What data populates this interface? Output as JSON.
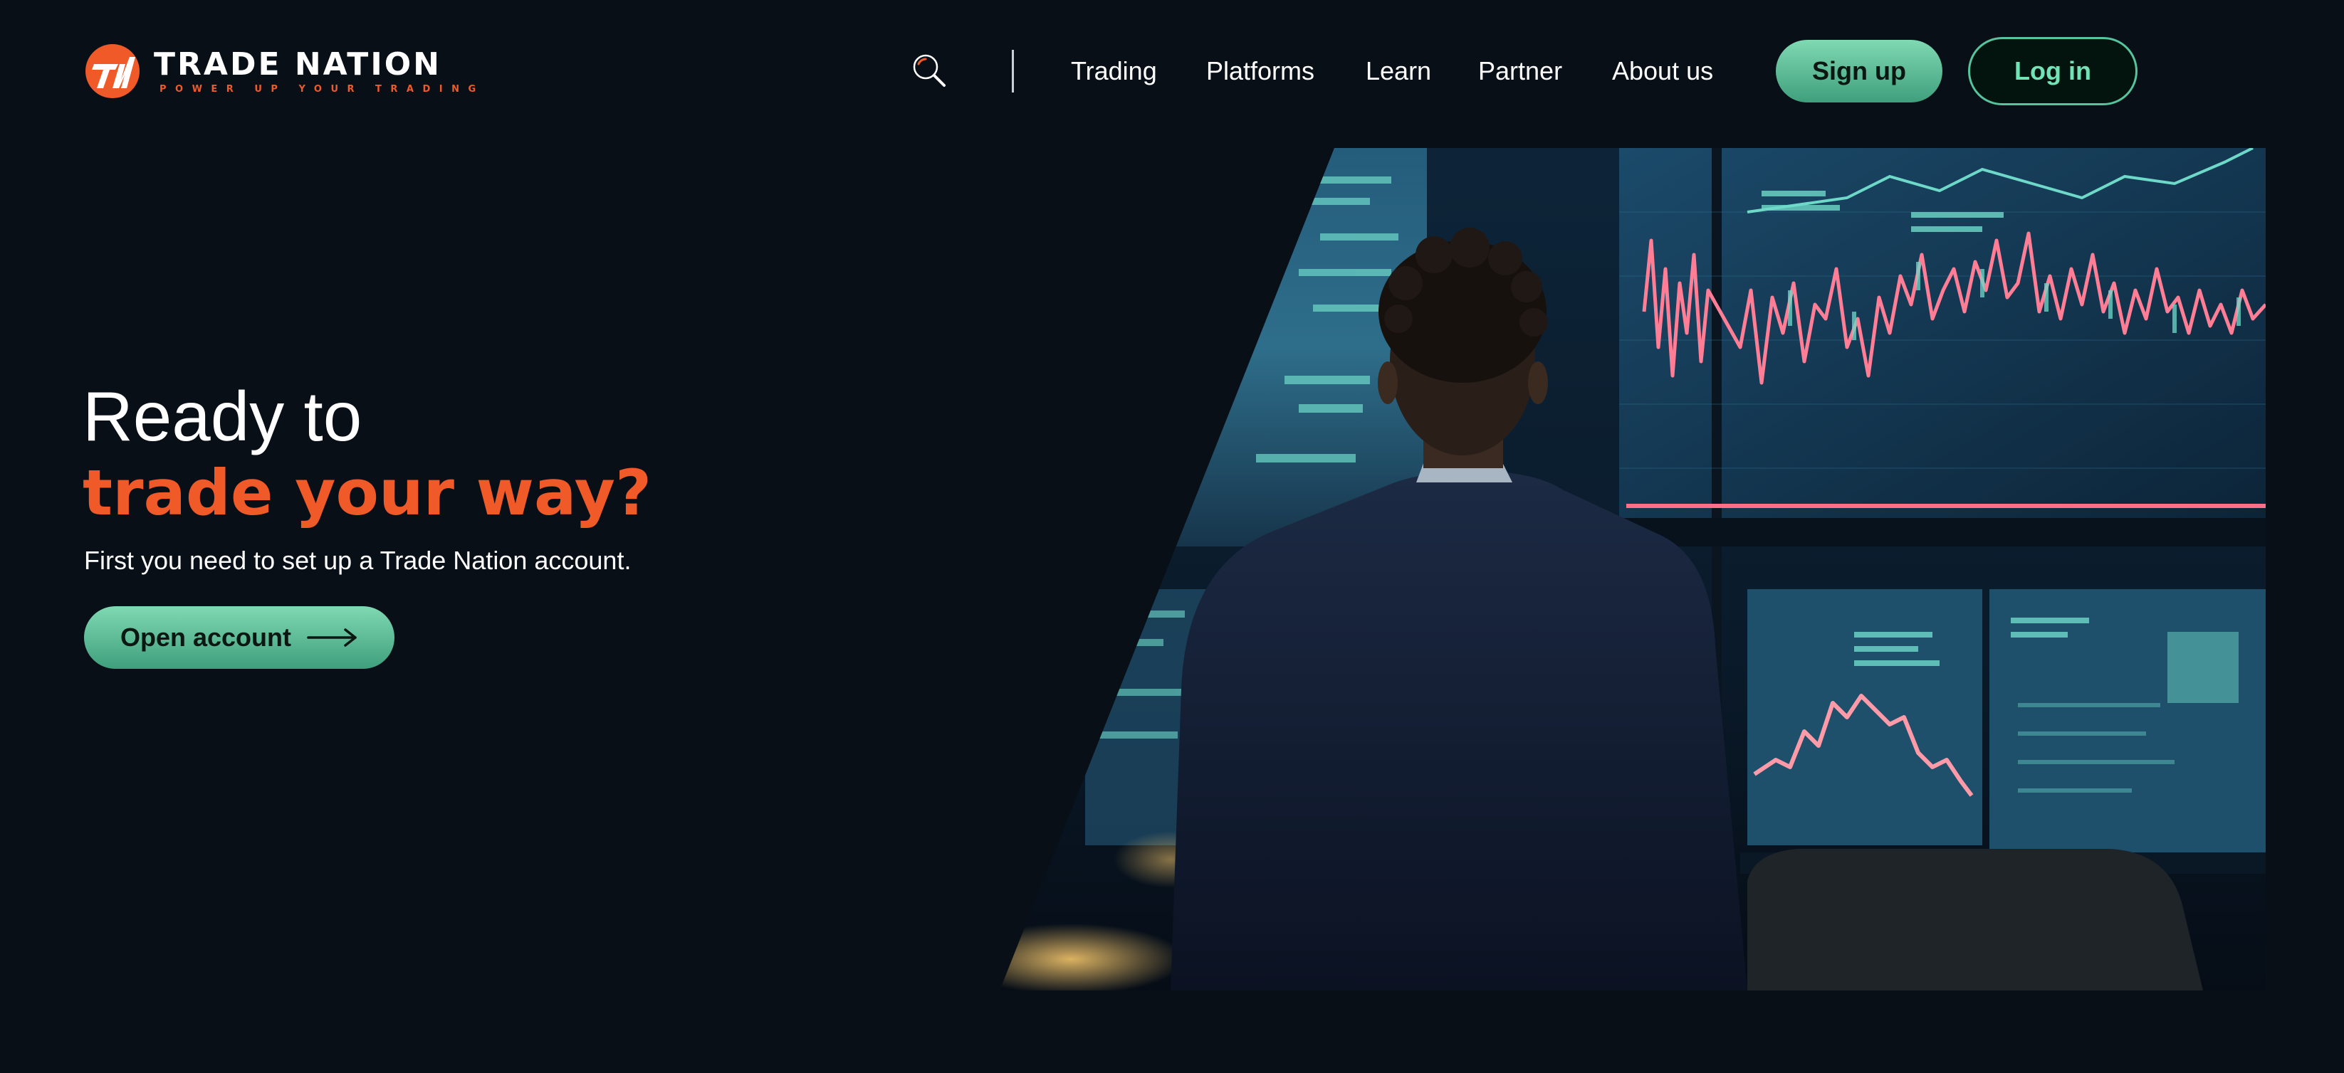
{
  "header": {
    "logo": {
      "name": "TRADE NATION",
      "tagline": "POWER UP YOUR TRADING",
      "icon": "trade-nation-logo"
    },
    "search_icon": "search-icon",
    "nav": [
      "Trading",
      "Platforms",
      "Learn",
      "Partner",
      "About us"
    ],
    "signup_label": "Sign up",
    "login_label": "Log in"
  },
  "hero": {
    "line1": "Ready to",
    "line2": "trade your way?",
    "subtitle": "First you need to set up a Trade Nation account.",
    "cta_label": "Open account",
    "cta_icon": "arrow-right-icon"
  },
  "colors": {
    "background": "#080f17",
    "accent_orange": "#ef5a28",
    "accent_green": "#6fd0a8"
  }
}
